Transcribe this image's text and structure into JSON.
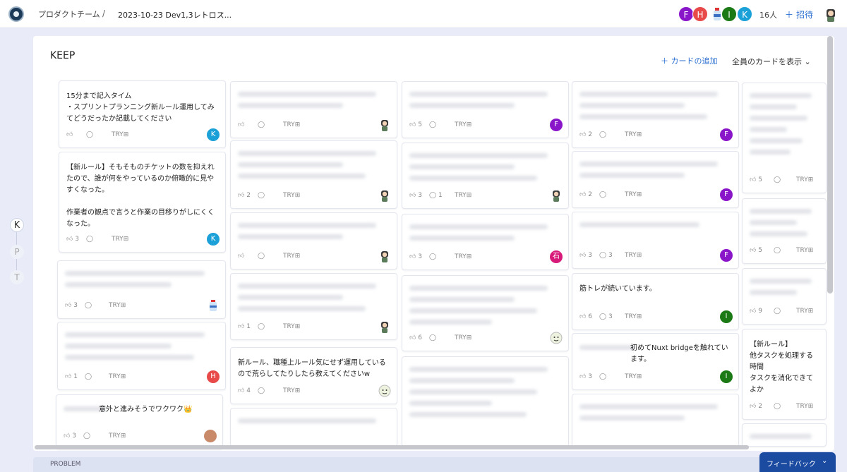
{
  "header": {
    "team": "プロダクトチーム",
    "separator": "/",
    "retro_name": "2023-10-23 Dev1,3レトロス...",
    "member_count": "16人",
    "invite_label": "招待",
    "members": [
      {
        "initial": "F",
        "color": "#8a16c9"
      },
      {
        "initial": "H",
        "color": "#e84a4a"
      },
      {
        "initial": "",
        "color": "#ffffff",
        "icon": "bottle-icon"
      },
      {
        "initial": "I",
        "color": "#1c7a16"
      },
      {
        "initial": "K",
        "color": "#1ba0d8"
      }
    ]
  },
  "column": {
    "title": "KEEP",
    "add_card_label": "カードの追加",
    "filter_label": "全員のカードを表示"
  },
  "side_tabs": [
    "K",
    "P",
    "T"
  ],
  "next_section": "PROBLEM",
  "feedback_label": "フィードバック",
  "try_label": "TRY",
  "cards": [
    {
      "id": "c1",
      "text": "15分まで記入タイム\n・スプリントプランニング新ルール運用してみてどうだったか記載してください",
      "likes": "",
      "comments": "",
      "avatar": {
        "initial": "K",
        "color": "#1ba0d8"
      }
    },
    {
      "id": "c2",
      "text": "【新ルール】そもそものチケットの数を抑えれたので、誰が何をやっているのか俯瞰的に見やすくなった。\n\n作業者の観点で言うと作業の目移りがしにくくなった。",
      "likes": "3",
      "comments": "",
      "avatar": {
        "initial": "K",
        "color": "#1ba0d8"
      }
    },
    {
      "id": "c3",
      "text": "",
      "likes": "3",
      "comments": "",
      "avatar": {
        "initial": "",
        "color": "#ffffff",
        "icon": "bottle-icon"
      }
    },
    {
      "id": "c4",
      "text": "",
      "likes": "1",
      "comments": "",
      "avatar": {
        "initial": "H",
        "color": "#e84a4a"
      }
    },
    {
      "id": "c5",
      "text": "意外と進みそうでワクワク👑",
      "likes": "3",
      "comments": "",
      "avatar": {
        "initial": "",
        "color": "#c98a6a"
      }
    },
    {
      "id": "c6",
      "text": "",
      "likes": "",
      "comments": "",
      "avatar": {
        "initial": "",
        "color": "#ffffff",
        "icon": "person-icon"
      }
    },
    {
      "id": "c7",
      "text": "",
      "likes": "2",
      "comments": "",
      "avatar": {
        "initial": "",
        "color": "#ffffff",
        "icon": "person-icon"
      }
    },
    {
      "id": "c8",
      "text": "",
      "likes": "",
      "comments": "",
      "avatar": {
        "initial": "",
        "color": "#ffffff",
        "icon": "person-icon"
      }
    },
    {
      "id": "c9",
      "text": "",
      "likes": "1",
      "comments": "",
      "avatar": {
        "initial": "",
        "color": "#ffffff",
        "icon": "person-icon"
      }
    },
    {
      "id": "c10",
      "text": "新ルール、職種上ルール気にせず運用しているので荒らしてたりしたら教えてくださいw",
      "likes": "4",
      "comments": "",
      "avatar": {
        "initial": "",
        "color": "#ffffff",
        "icon": "face-icon"
      }
    },
    {
      "id": "c11",
      "text": "",
      "likes": "5",
      "comments": "",
      "avatar": {
        "initial": "F",
        "color": "#8a16c9"
      }
    },
    {
      "id": "c12",
      "text": "",
      "likes": "3",
      "comments": "1",
      "avatar": {
        "initial": "",
        "color": "#ffffff",
        "icon": "person-icon"
      }
    },
    {
      "id": "c13",
      "text": "",
      "likes": "3",
      "comments": "",
      "avatar": {
        "initial": "石",
        "color": "#d81b7a"
      }
    },
    {
      "id": "c14",
      "text": "",
      "likes": "6",
      "comments": "",
      "avatar": {
        "initial": "",
        "color": "#ffffff",
        "icon": "face-icon"
      }
    },
    {
      "id": "c15",
      "text": "",
      "likes": "2",
      "comments": "",
      "avatar": {
        "initial": "F",
        "color": "#8a16c9"
      }
    },
    {
      "id": "c16",
      "text": "",
      "likes": "2",
      "comments": "",
      "avatar": {
        "initial": "F",
        "color": "#8a16c9"
      }
    },
    {
      "id": "c17",
      "text": "",
      "likes": "3",
      "comments": "3",
      "avatar": {
        "initial": "F",
        "color": "#8a16c9"
      }
    },
    {
      "id": "c18",
      "text": "筋トレが続いています。",
      "likes": "6",
      "comments": "3",
      "avatar": {
        "initial": "I",
        "color": "#1c7a16"
      }
    },
    {
      "id": "c19",
      "text": "初めてNuxt bridgeを触れています。",
      "likes": "3",
      "comments": "",
      "avatar": {
        "initial": "I",
        "color": "#1c7a16"
      }
    },
    {
      "id": "c20",
      "text": "",
      "likes": "5",
      "comments": ""
    },
    {
      "id": "c21",
      "text": "",
      "likes": "5",
      "comments": ""
    },
    {
      "id": "c22",
      "text": "",
      "likes": "9",
      "comments": ""
    },
    {
      "id": "c23",
      "text": "【新ルール】\n他タスクを処理する時間\nタスクを消化できてよか",
      "likes": "2",
      "comments": ""
    }
  ]
}
